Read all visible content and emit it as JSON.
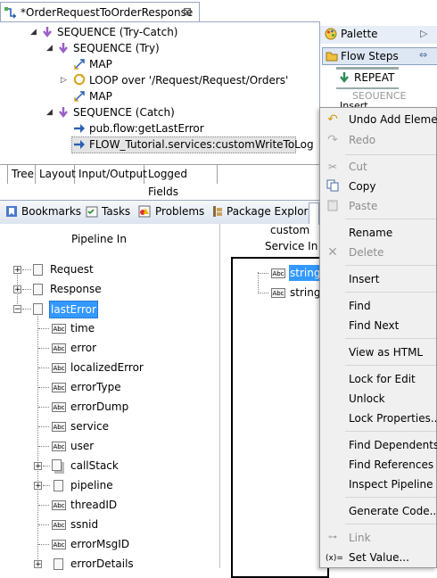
{
  "editor": {
    "tab_title": "*OrderRequestToOrderResponse",
    "close_glyph": "⊠",
    "flow_steps": [
      {
        "label": "SEQUENCE (Try-Catch)"
      },
      {
        "label": "SEQUENCE (Try)"
      },
      {
        "label": "MAP"
      },
      {
        "label": "LOOP over '/Request/Request/Orders'"
      },
      {
        "label": "MAP"
      },
      {
        "label": "SEQUENCE (Catch)"
      },
      {
        "label": "pub.flow:getLastError"
      },
      {
        "label": "FLOW_Tutorial.services:customWriteToLog"
      }
    ],
    "sub_tabs": [
      "Tree",
      "Layout",
      "Input/Output",
      "Logged Fields"
    ]
  },
  "palette": {
    "title": "Palette",
    "group": "Flow Steps",
    "items": [
      "REPEAT",
      "SEQUENCE",
      "Insert"
    ]
  },
  "views": {
    "tabs": [
      "Bookmarks",
      "Tasks",
      "Problems",
      "Package Explorer"
    ]
  },
  "pipeline": {
    "left_title": "Pipeline In",
    "right_title_1": "custom",
    "right_title_2": "Service In",
    "left_nodes": [
      "Request",
      "Response",
      "lastError"
    ],
    "lasterror_children": [
      "time",
      "error",
      "localizedError",
      "errorType",
      "errorDump",
      "service",
      "user",
      "callStack",
      "pipeline",
      "threadID",
      "ssnid",
      "errorMsgID",
      "errorDetails"
    ],
    "right_nodes": [
      "string",
      "string."
    ]
  },
  "context_menu": {
    "items": [
      {
        "label": "Undo Add Element",
        "disabled": false
      },
      {
        "label": "Redo",
        "disabled": true
      },
      {
        "label": "Cut",
        "disabled": true
      },
      {
        "label": "Copy",
        "disabled": false
      },
      {
        "label": "Paste",
        "disabled": true
      },
      {
        "label": "Rename",
        "disabled": false
      },
      {
        "label": "Delete",
        "disabled": true
      },
      {
        "label": "Insert",
        "disabled": false
      },
      {
        "label": "Find",
        "disabled": false
      },
      {
        "label": "Find Next",
        "disabled": false
      },
      {
        "label": "View as HTML",
        "disabled": false
      },
      {
        "label": "Lock for Edit",
        "disabled": false
      },
      {
        "label": "Unlock",
        "disabled": false
      },
      {
        "label": "Lock Properties...",
        "disabled": false
      },
      {
        "label": "Find Dependents",
        "disabled": false
      },
      {
        "label": "Find References",
        "disabled": false
      },
      {
        "label": "Inspect Pipeline Re",
        "disabled": false
      },
      {
        "label": "Generate Code...",
        "disabled": false
      },
      {
        "label": "Link",
        "disabled": true
      },
      {
        "label": "Set Value...",
        "disabled": false
      }
    ]
  },
  "colors": {
    "selection": "#3399ff",
    "tab_border": "#99a8c0",
    "sequence_icon": "#9a5ec8",
    "invoke_icon": "#2b5fb3",
    "loop_icon": "#d6a31a"
  }
}
